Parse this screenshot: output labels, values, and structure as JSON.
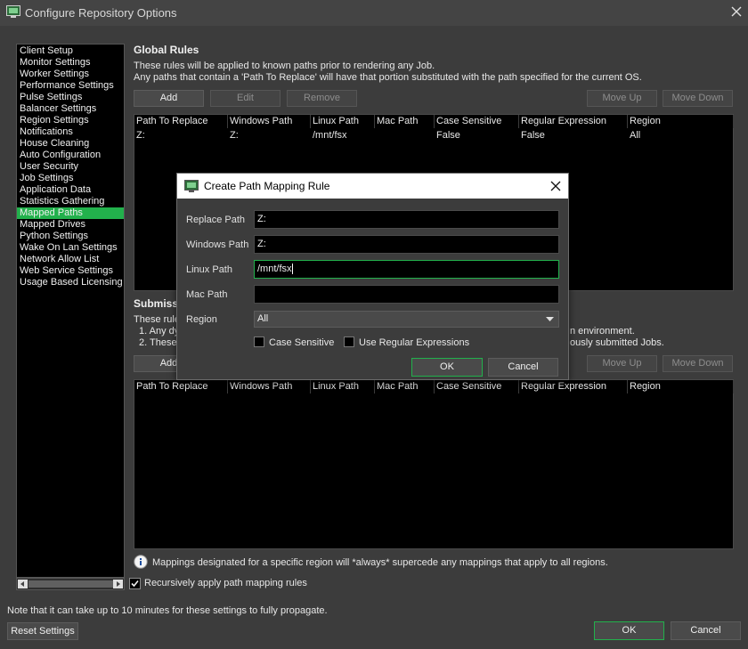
{
  "window": {
    "title": "Configure Repository Options"
  },
  "sidebar": {
    "items": [
      "Client Setup",
      "Monitor Settings",
      "Worker Settings",
      "Performance Settings",
      "Pulse Settings",
      "Balancer Settings",
      "Region Settings",
      "Notifications",
      "House Cleaning",
      "Auto Configuration",
      "User Security",
      "Job Settings",
      "Application Data",
      "Statistics Gathering",
      "Mapped Paths",
      "Mapped Drives",
      "Python Settings",
      "Wake On Lan Settings",
      "Network Allow List",
      "Web Service Settings",
      "Usage Based Licensing"
    ],
    "active_index": 14
  },
  "global_rules": {
    "heading": "Global Rules",
    "desc_line1": "These rules will be applied to known paths prior to rendering any Job.",
    "desc_line2": "Any paths that contain a 'Path To Replace' will have that portion substituted with the path specified for the current OS.",
    "buttons": {
      "add": "Add",
      "edit": "Edit",
      "remove": "Remove",
      "move_up": "Move Up",
      "move_down": "Move Down"
    },
    "columns": [
      "Path To Replace",
      "Windows Path",
      "Linux Path",
      "Mac Path",
      "Case Sensitive",
      "Regular Expression",
      "Region"
    ],
    "rows": [
      [
        "Z:",
        "Z:",
        "/mnt/fsx",
        "",
        "False",
        "False",
        "All"
      ]
    ]
  },
  "submission": {
    "heading_partial": "Submissi",
    "desc_partial": "These rule",
    "item1_partial": "1. Any dy",
    "item1_tail": "n environment.",
    "item2_partial": "2. These",
    "item2_tail": "ously submitted Jobs.",
    "buttons": {
      "add": "Add",
      "move_up": "Move Up",
      "move_down": "Move Down"
    },
    "columns": [
      "Path To Replace",
      "Windows Path",
      "Linux Path",
      "Mac Path",
      "Case Sensitive",
      "Regular Expression",
      "Region"
    ]
  },
  "info_note": "Mappings designated for a specific region will *always* supercede any mappings that apply to all regions.",
  "recursive_checkbox": {
    "label": "Recursively apply path mapping rules",
    "checked": true
  },
  "footer": {
    "note": "Note that it can take up to 10 minutes for these settings to fully propagate.",
    "reset": "Reset Settings",
    "ok": "OK",
    "cancel": "Cancel"
  },
  "dialog": {
    "title": "Create Path Mapping Rule",
    "fields": {
      "replace_label": "Replace Path",
      "replace_value": "Z:",
      "windows_label": "Windows Path",
      "windows_value": "Z:",
      "linux_label": "Linux Path",
      "linux_value": "/mnt/fsx",
      "mac_label": "Mac Path",
      "mac_value": "",
      "region_label": "Region",
      "region_value": "All"
    },
    "case_sensitive": {
      "label": "Case Sensitive",
      "checked": false
    },
    "regex": {
      "label": "Use Regular Expressions",
      "checked": false
    },
    "ok": "OK",
    "cancel": "Cancel"
  },
  "colors": {
    "accent": "#22b14c",
    "background": "#3c3c3c",
    "panel": "#000000"
  }
}
